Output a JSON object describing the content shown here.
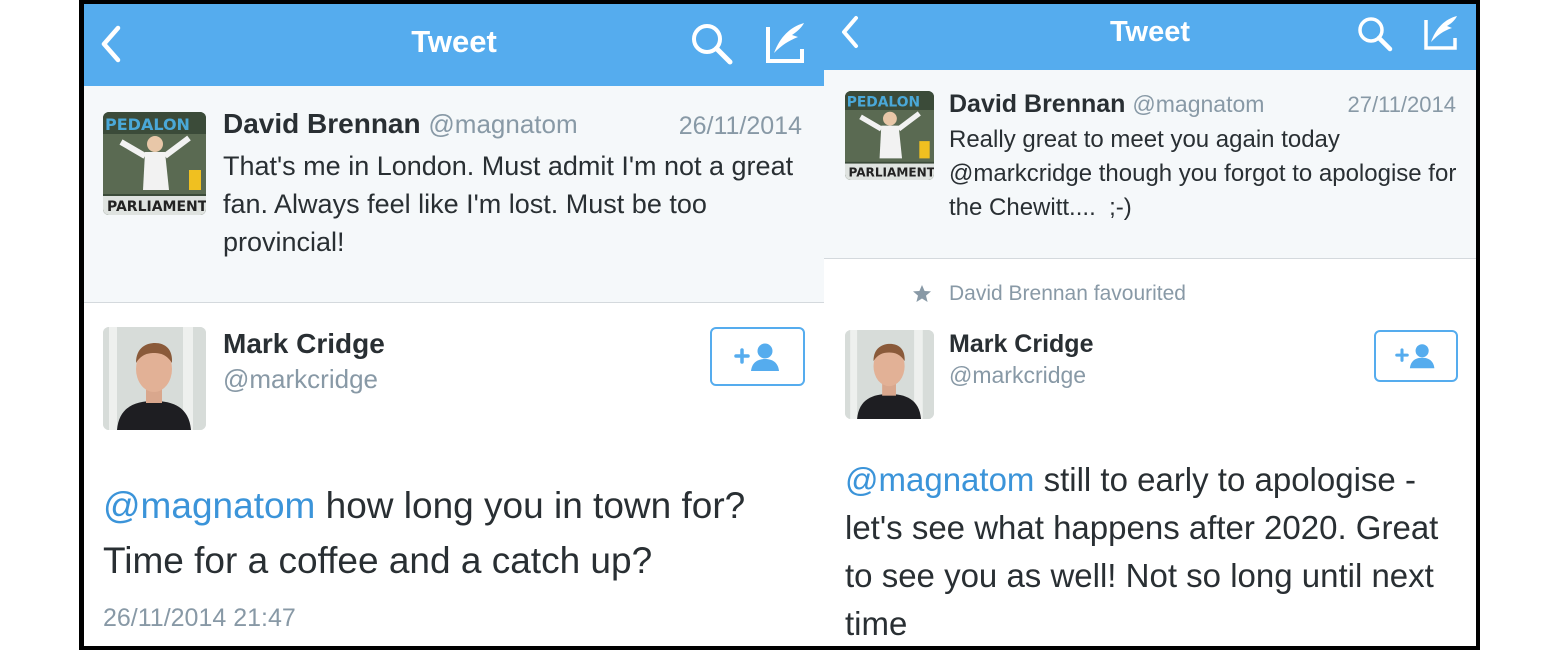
{
  "colors": {
    "nav_blue": "#55acee",
    "mention_blue": "#3b94d9",
    "text_dark": "#292f33",
    "text_gray": "#8899a6",
    "quote_bg": "#f5f8fa"
  },
  "left": {
    "nav": {
      "title": "Tweet",
      "back_icon": "chevron-left-icon",
      "search_icon": "search-icon",
      "compose_icon": "compose-icon"
    },
    "quoted": {
      "avatar_text_top": "PEDALON",
      "avatar_text_bottom": "PARLIAMENT",
      "name": "David Brennan",
      "handle": "@magnatom",
      "date": "26/11/2014",
      "text": "That's me in London. Must admit I'm not a great fan. Always feel like I'm lost. Must be too provincial!"
    },
    "author": {
      "name": "Mark Cridge",
      "handle": "@markcridge",
      "follow_icon": "follow-icon"
    },
    "tweet": {
      "mention": "@magnatom",
      "text": " how long you in town for? Time for a coffee and a catch up?",
      "timestamp": "26/11/2014 21:47"
    }
  },
  "right": {
    "nav": {
      "title": "Tweet",
      "back_icon": "chevron-left-icon",
      "search_icon": "search-icon",
      "compose_icon": "compose-icon"
    },
    "quoted": {
      "avatar_text_top": "PEDALON",
      "avatar_text_bottom": "PARLIAMENT",
      "name": "David Brennan",
      "handle": "@magnatom",
      "date": "27/11/2014",
      "text": "Really great to meet you again today @markcridge though you forgot to apologise for the Chewitt....  ;-)"
    },
    "favourited": "David Brennan favourited",
    "author": {
      "name": "Mark Cridge",
      "handle": "@markcridge",
      "follow_icon": "follow-icon"
    },
    "tweet": {
      "mention": "@magnatom",
      "text": " still to early to apologise - let's see what happens after 2020. Great to see you as well! Not so long until next time"
    }
  }
}
